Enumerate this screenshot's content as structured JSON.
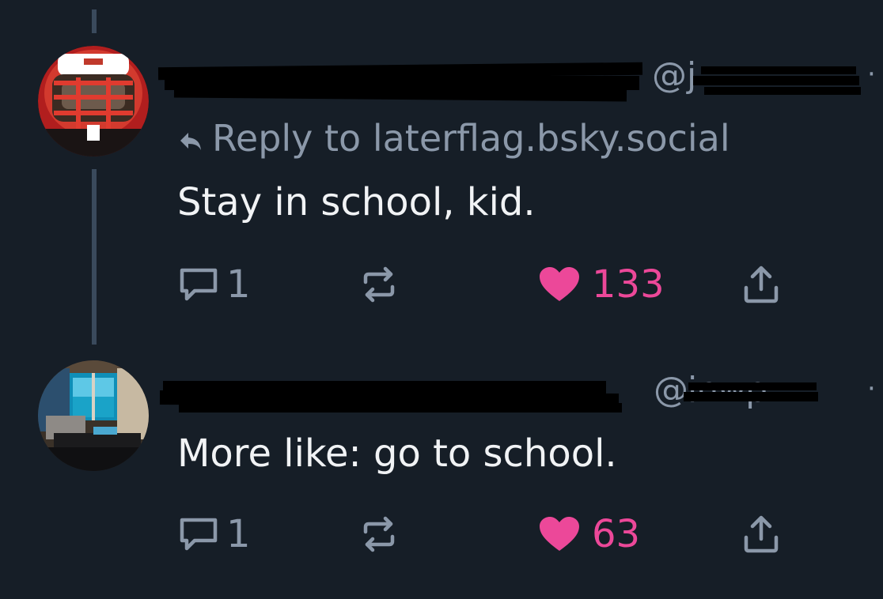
{
  "posts": [
    {
      "display_name": "",
      "handle": "@j",
      "separator": "·",
      "reply_to": "Reply to laterflag.bsky.social",
      "text": "Stay in school, kid.",
      "reply_count": "1",
      "repost_count": "",
      "like_count": "133",
      "liked": true
    },
    {
      "display_name": "",
      "handle": "@inwp...",
      "separator": "·",
      "reply_to": "",
      "text": "More like: go to school.",
      "reply_count": "1",
      "repost_count": "",
      "like_count": "63",
      "liked": true
    }
  ],
  "icons": {
    "reply": "reply-arrow-icon",
    "comment": "speech-bubble-icon",
    "repost": "repost-arrows-icon",
    "like": "heart-icon",
    "share": "share-upload-icon"
  },
  "colors": {
    "background": "#161e27",
    "text": "#f1f3f5",
    "muted": "#8b98a9",
    "like": "#ec4899",
    "thread_line": "#3a4a5c"
  }
}
